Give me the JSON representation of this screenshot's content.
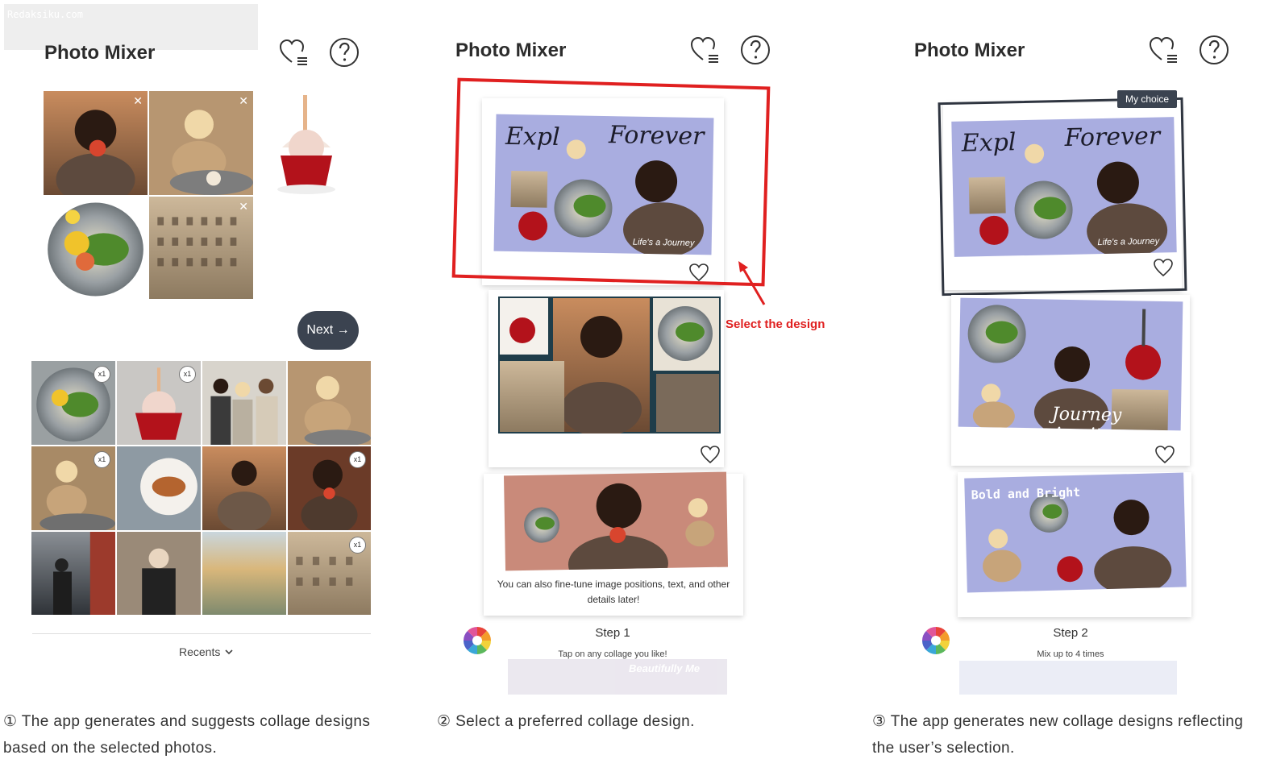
{
  "watermark": "Redaksiku.com",
  "app": {
    "title": "Photo Mixer",
    "favorites_icon": "heart-list-icon",
    "help_icon": "question-circle-icon"
  },
  "panel1": {
    "next_label": "Next →",
    "recents_label": "Recents",
    "badge_label": "x1",
    "caption": "① The app generates and suggests collage designs based on the selected photos."
  },
  "panel2": {
    "card1_title_a": "Expl",
    "card1_title_b": "Forever",
    "card1_subtitle": "Life's a Journey",
    "annotation": "Select the design",
    "card3_tip": "You can also fine-tune image positions, text, and other details later!",
    "step_title": "Step 1",
    "step_sub": "Tap on any collage you like!",
    "peek_text": "Beautifully Me",
    "caption": "② Select a preferred collage design."
  },
  "panel3": {
    "my_choice": "My choice",
    "card1_title_a": "Expl",
    "card1_title_b": "Forever",
    "card1_subtitle": "Life's a Journey",
    "card2_text": "Journey Awaits",
    "card3_text": "Bold and Bright",
    "step_title": "Step 2",
    "step_sub": "Mix up to 4 times",
    "caption": "③ The app generates new collage designs reflecting the user’s selection."
  },
  "colors": {
    "accent_dark": "#3b4350",
    "annotation_red": "#e02020",
    "collage_lavender": "#a9ade0",
    "collage_rose": "#c98a7a"
  }
}
